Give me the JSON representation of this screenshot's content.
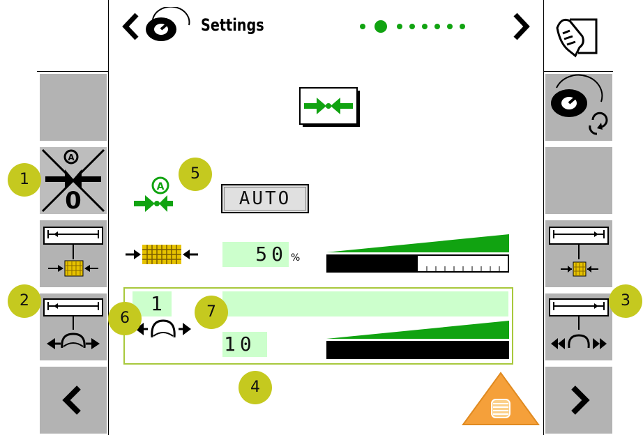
{
  "header": {
    "title": "Settings",
    "page_indicator": {
      "total": 8,
      "active_index": 1
    },
    "prev_icon": "chevron-left-icon",
    "next_icon": "chevron-right-icon",
    "title_icon": "gauge-icon",
    "hand_icon": "hand-lever-icon"
  },
  "main": {
    "mode_value": "AUTO",
    "bale_density": {
      "value": "50",
      "unit": "%",
      "level": 0.5
    },
    "row": {
      "index": "1"
    },
    "pressure": {
      "value": "10",
      "level": 1.0
    }
  },
  "callouts": [
    "1",
    "2",
    "3",
    "4",
    "5",
    "6",
    "7"
  ],
  "colors": {
    "accent_green": "#11a311",
    "lcd_green": "#ccffcc",
    "softkey_gray": "#b3b3b3",
    "callout_yellow": "#c5c91f",
    "warning_orange": "#f5a03a"
  }
}
